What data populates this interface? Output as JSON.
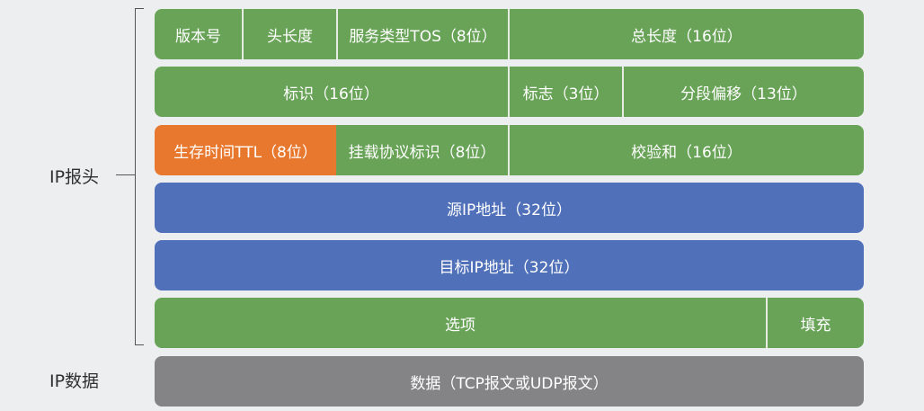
{
  "labels": {
    "ip_header": "IP报头",
    "ip_data": "IP数据"
  },
  "colors": {
    "green": "#68a357",
    "orange": "#e8782d",
    "blue": "#5071b9",
    "gray": "#848486"
  },
  "header_rows": {
    "row1": {
      "version": "版本号",
      "header_length": "头长度",
      "tos": "服务类型TOS（8位）",
      "total_length": "总长度（16位）"
    },
    "row2": {
      "identification": "标识（16位）",
      "flags": "标志（3位）",
      "fragment_offset": "分段偏移（13位）"
    },
    "row3": {
      "ttl": "生存时间TTL（8位）",
      "protocol": "挂载协议标识（8位）",
      "checksum": "校验和（16位）"
    },
    "row4": {
      "source_ip": "源IP地址（32位）"
    },
    "row5": {
      "destination_ip": "目标IP地址（32位）"
    },
    "row6": {
      "options": "选项",
      "padding": "填充"
    }
  },
  "data_row": {
    "data": "数据（TCP报文或UDP报文）"
  }
}
